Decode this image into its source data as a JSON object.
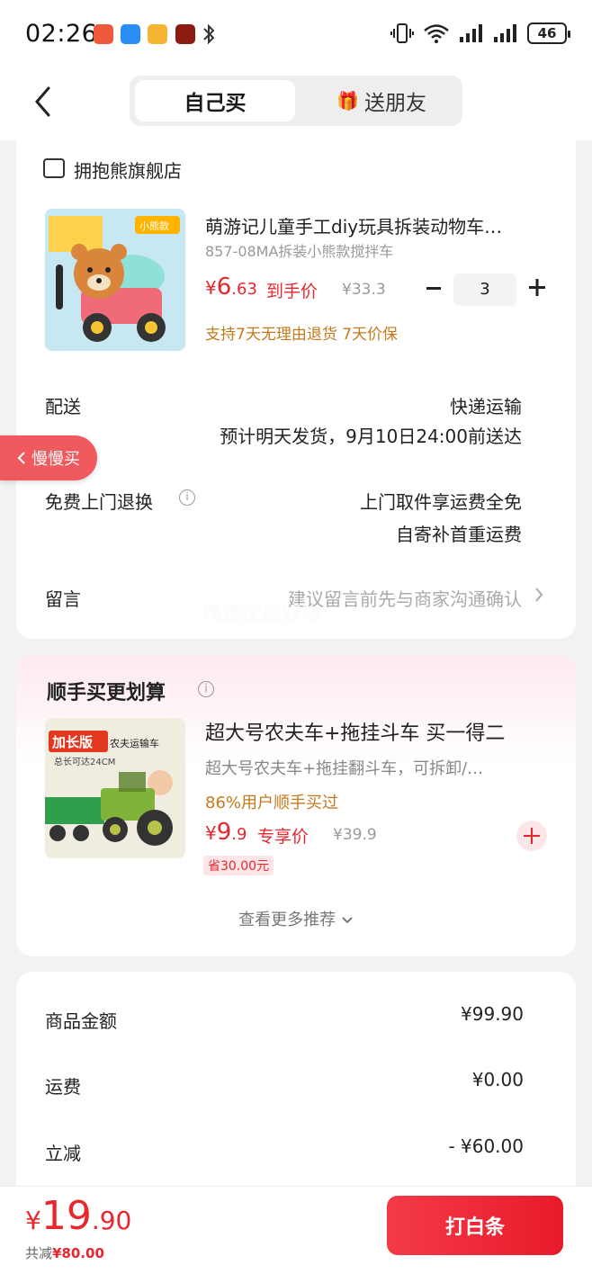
{
  "status_bar": {
    "time": "02:26",
    "battery": "46",
    "icons": [
      "missed-call-icon",
      "message-icon",
      "email-icon",
      "app-icon",
      "bluetooth-icon",
      "vibrate-icon",
      "wifi-icon",
      "signal-icon",
      "signal-icon-2"
    ]
  },
  "header": {
    "tab_self": "自己买",
    "tab_friend": "送朋友"
  },
  "order": {
    "store_name": "拥抱熊旗舰店",
    "product": {
      "title": "萌游记儿童手工diy玩具拆装动物车…",
      "sku": "857-08MA拆装小熊款搅拌车",
      "price_symbol": "¥",
      "price_int": "6",
      "price_dec": ".63",
      "price_tag": "到手价",
      "orig_price": "¥33.3",
      "quantity": "3",
      "promise": "支持7天无理由退货  7天价保",
      "image_badge": "小熊款"
    },
    "delivery_label": "配送",
    "delivery_value": "快递运输",
    "delivery_eta": "预计明天发货，9月10日24:00前送达",
    "return_label": "免费上门退换",
    "return_value_1": "上门取件享运费全免",
    "return_value_2": "自寄补首重运费",
    "message_label": "留言",
    "message_placeholder": "建议留言前先与商家沟通确认"
  },
  "slow_buy": "慢慢买",
  "watermark": "精选优质好物",
  "addon": {
    "title": "顺手买更划算",
    "item": {
      "title": "超大号农夫车+拖挂斗车 买一得二",
      "subtitle": "超大号农夫车+拖挂翻斗车，可拆卸/…",
      "popularity": "86%用户顺手买过",
      "price_symbol": "¥",
      "price_int": "9",
      "price_dec": ".9",
      "price_tag": "专享价",
      "orig_price": "¥39.9",
      "save": "省30.00元",
      "image_badge": "加长版",
      "image_caption": "农夫运输车",
      "image_length": "总长可达24CM"
    },
    "more": "查看更多推荐"
  },
  "summary": {
    "goods_label": "商品金额",
    "goods_value": "¥99.90",
    "shipping_label": "运费",
    "shipping_value": "¥0.00",
    "discount_label": "立减",
    "discount_value": "- ¥60.00"
  },
  "footer": {
    "total_symbol": "¥",
    "total_int": "19",
    "total_dec": ".90",
    "save_prefix": "共减",
    "save_value": "¥80.00",
    "pay_button": "打白条"
  },
  "colors": {
    "accent": "#e8262d",
    "promise": "#c47a1b",
    "button_start": "#f43a47",
    "button_end": "#e81a2b"
  }
}
